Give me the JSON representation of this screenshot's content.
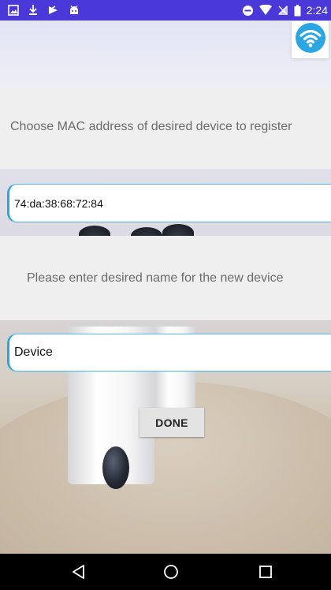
{
  "status_bar": {
    "time": "2:24",
    "left_icons": [
      "image-icon",
      "download-icon",
      "media-icon",
      "android-icon"
    ],
    "right_icons": [
      "dnd-icon",
      "wifi-signal-icon",
      "cell-signal-icon",
      "battery-icon"
    ]
  },
  "header": {
    "wifi_button_icon": "wifi-icon",
    "accent_color": "#2aa6e2"
  },
  "mac_section": {
    "prompt": "Choose MAC address of desired device to register",
    "value": "74:da:38:68:72:84"
  },
  "name_section": {
    "prompt": "Please enter desired name for the new device",
    "value": "Device"
  },
  "actions": {
    "done_label": "DONE"
  },
  "nav_bar": {
    "back_icon": "back-triangle-icon",
    "home_icon": "home-circle-icon",
    "recent_icon": "recents-square-icon"
  }
}
